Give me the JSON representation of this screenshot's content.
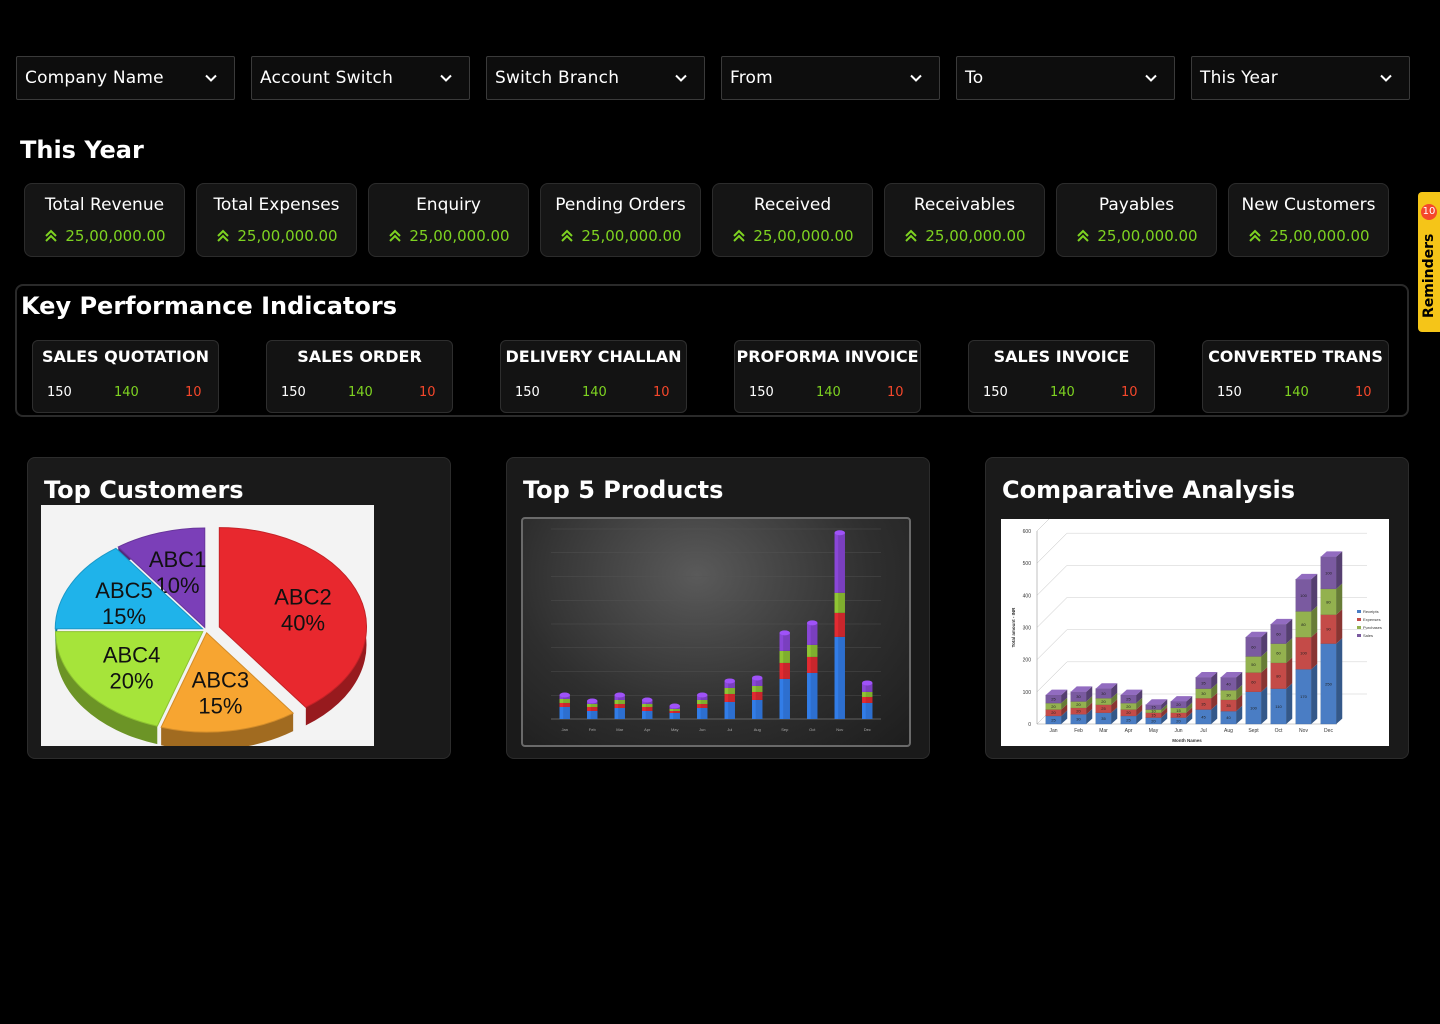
{
  "filters": [
    "Company Name",
    "Account Switch",
    "Switch Branch",
    "From",
    "To",
    "This Year"
  ],
  "period_title": "This Year",
  "stats": [
    {
      "label": "Total Revenue",
      "value": "25,00,000.00"
    },
    {
      "label": "Total Expenses",
      "value": "25,00,000.00"
    },
    {
      "label": "Enquiry",
      "value": "25,00,000.00"
    },
    {
      "label": "Pending Orders",
      "value": "25,00,000.00"
    },
    {
      "label": "Received",
      "value": "25,00,000.00"
    },
    {
      "label": "Receivables",
      "value": "25,00,000.00"
    },
    {
      "label": "Payables",
      "value": "25,00,000.00"
    },
    {
      "label": "New Customers",
      "value": "25,00,000.00"
    }
  ],
  "kpi": {
    "title": "Key Performance Indicators",
    "cards": [
      {
        "name": "SALES QUOTATION",
        "values": [
          "150",
          "140",
          "10"
        ]
      },
      {
        "name": "SALES ORDER",
        "values": [
          "150",
          "140",
          "10"
        ]
      },
      {
        "name": "DELIVERY CHALLAN",
        "values": [
          "150",
          "140",
          "10"
        ]
      },
      {
        "name": "PROFORMA INVOICE",
        "values": [
          "150",
          "140",
          "10"
        ]
      },
      {
        "name": "SALES INVOICE",
        "values": [
          "150",
          "140",
          "10"
        ]
      },
      {
        "name": "CONVERTED TRANS",
        "values": [
          "150",
          "140",
          "10"
        ]
      }
    ]
  },
  "reminders": {
    "label": "Reminders",
    "count": "10"
  },
  "panels": {
    "top_customers": "Top Customers",
    "top_products": "Top 5 Products",
    "comparative": "Comparative Analysis"
  },
  "colors": {
    "positive": "#7ed321",
    "negative": "#f5472b",
    "reminder": "#f5c518"
  },
  "chart_data": [
    {
      "type": "pie",
      "categories": [
        "ABC1",
        "ABC2",
        "ABC3",
        "ABC4",
        "ABC5"
      ],
      "values": [
        10,
        40,
        15,
        20,
        15
      ],
      "labels": [
        "10%",
        "40%",
        "15%",
        "20%",
        "15%"
      ],
      "colors": [
        "#7b3fb8",
        "#e8282e",
        "#f7a531",
        "#a6e43a",
        "#1fb3ea"
      ]
    },
    {
      "type": "bar",
      "stacked": true,
      "categories": [
        "Jan",
        "Feb",
        "Mar",
        "Apr",
        "May",
        "Jun",
        "Jul",
        "Aug",
        "Sep",
        "Oct",
        "Nov",
        "Dec"
      ],
      "series": [
        {
          "values": [
            60,
            40,
            55,
            40,
            30,
            55,
            85,
            95,
            200,
            230,
            410,
            80
          ]
        },
        {
          "values": [
            20,
            20,
            20,
            20,
            10,
            20,
            40,
            40,
            80,
            80,
            120,
            30
          ]
        },
        {
          "values": [
            20,
            15,
            20,
            15,
            10,
            20,
            30,
            30,
            60,
            60,
            100,
            25
          ]
        },
        {
          "values": [
            20,
            15,
            25,
            20,
            15,
            25,
            35,
            40,
            90,
            110,
            300,
            45
          ]
        }
      ],
      "colors": [
        "#2d6fcf",
        "#c9262c",
        "#7fae2e",
        "#7a3fbf",
        "#27a7d8"
      ]
    },
    {
      "type": "bar",
      "stacked": true,
      "categories": [
        "Jan",
        "Feb",
        "Mar",
        "Apr",
        "May",
        "Jun",
        "Jul",
        "Aug",
        "Sept",
        "Oct",
        "Nov",
        "Dec"
      ],
      "series": [
        {
          "name": "Receipts",
          "values": [
            25,
            30,
            35,
            25,
            20,
            20,
            45,
            40,
            100,
            110,
            170,
            250
          ]
        },
        {
          "name": "Expenses",
          "values": [
            20,
            20,
            25,
            20,
            15,
            15,
            35,
            35,
            60,
            80,
            100,
            90
          ]
        },
        {
          "name": "Purchases",
          "values": [
            20,
            20,
            20,
            20,
            10,
            15,
            30,
            30,
            50,
            60,
            80,
            80
          ]
        },
        {
          "name": "Sales",
          "values": [
            25,
            30,
            30,
            25,
            15,
            20,
            35,
            40,
            60,
            60,
            100,
            100
          ]
        }
      ],
      "ylim": [
        0,
        600
      ],
      "yticks": [
        "0",
        "100",
        "200",
        "300",
        "400",
        "500",
        "600"
      ],
      "ylabel": "Total amount - INR",
      "xlabel": "Month Names",
      "legend": "right",
      "colors": [
        "#4a7dc4",
        "#c44b48",
        "#93b14f",
        "#7a5aa0"
      ]
    }
  ]
}
